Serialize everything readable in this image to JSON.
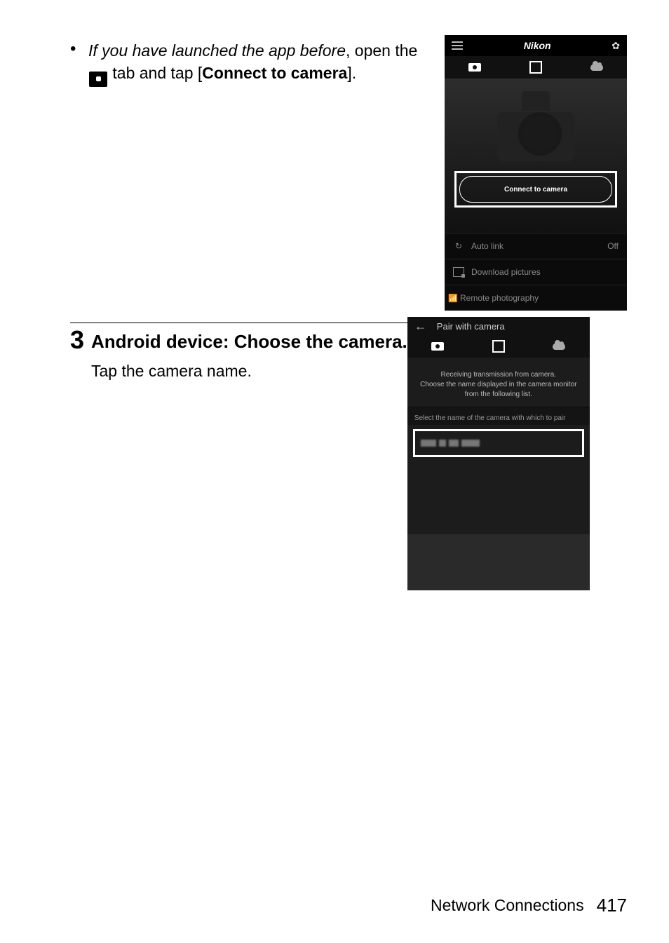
{
  "instruction1": {
    "lead_italic": "If you have launched the app before",
    "after_lead": ", open the",
    "after_icon": "tab and tap [",
    "bold_action": "Connect to camera",
    "tail": "]."
  },
  "app1": {
    "brand": "Nikon",
    "connect_button": "Connect to camera",
    "items": [
      {
        "icon": "refresh",
        "label": "Auto link",
        "value": "Off"
      },
      {
        "icon": "dl",
        "label": "Download pictures",
        "value": ""
      },
      {
        "icon": "remote",
        "label": "Remote photography",
        "value": ""
      }
    ]
  },
  "step3": {
    "number": "3",
    "title": "Android device: Choose the camera.",
    "body": "Tap the camera name."
  },
  "app2": {
    "title": "Pair with camera",
    "msg_line1": "Receiving transmission from camera.",
    "msg_line2": "Choose the name displayed in the camera monitor",
    "msg_line3": "from the following list.",
    "subhead": "Select the name of the camera with which to pair"
  },
  "footer": {
    "section": "Network Connections",
    "page": "417"
  }
}
